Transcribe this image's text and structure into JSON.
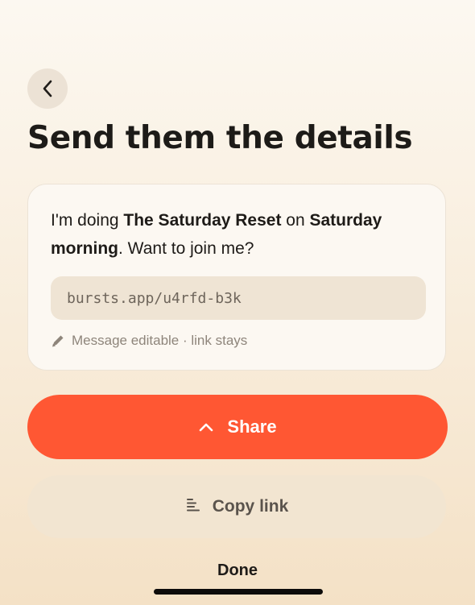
{
  "header": {
    "back_icon": "chevron-left-icon",
    "title": "Send them the details"
  },
  "card": {
    "message": {
      "prefix": "I'm doing ",
      "event_name": "The Saturday Reset",
      "middle": " on ",
      "time": "Saturday morning",
      "suffix": ". Want to join me?"
    },
    "link": "bursts.app/u4rfd-b3k",
    "hint_icon": "pencil-icon",
    "hint": "Message editable · link stays"
  },
  "actions": {
    "share_label": "Share",
    "share_icon": "chevron-up-icon",
    "copy_label": "Copy link",
    "copy_icon": "lines-icon",
    "done_label": "Done"
  },
  "colors": {
    "accent": "#ff5733",
    "card_bg": "#fcf8f2",
    "link_bg": "#efe4d4",
    "secondary_btn_bg": "#f2e5d1"
  }
}
